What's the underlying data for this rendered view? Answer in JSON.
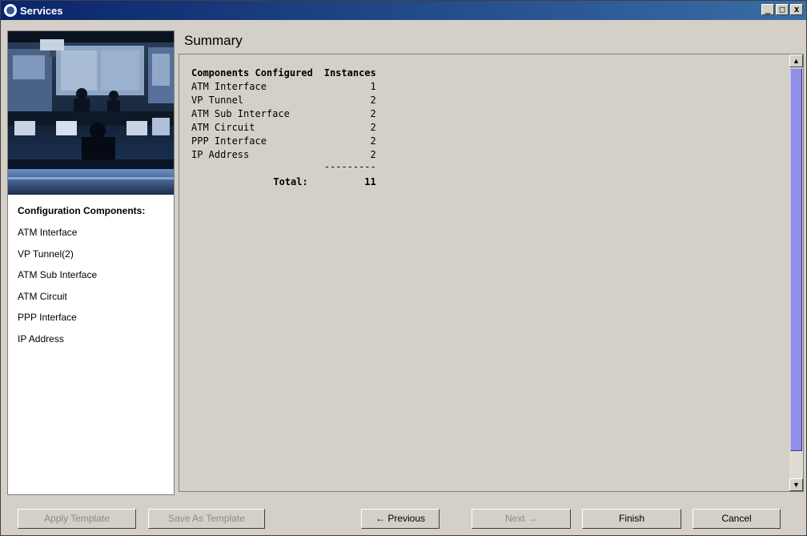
{
  "window": {
    "title": "Services",
    "buttons": {
      "minimize": "_",
      "maximize": "□",
      "close": "x"
    }
  },
  "sidebar": {
    "heading": "Configuration Components:",
    "items": [
      {
        "label": "ATM Interface"
      },
      {
        "label": "VP Tunnel(2)"
      },
      {
        "label": "ATM Sub Interface"
      },
      {
        "label": "ATM Circuit"
      },
      {
        "label": "PPP Interface"
      },
      {
        "label": "IP Address"
      }
    ]
  },
  "main": {
    "title": "Summary",
    "table": {
      "col_component": "Components Configured",
      "col_instances": "Instances",
      "rows": [
        {
          "name": "ATM Interface",
          "count": "1"
        },
        {
          "name": "VP Tunnel",
          "count": "2"
        },
        {
          "name": "ATM Sub Interface",
          "count": "2"
        },
        {
          "name": "ATM Circuit",
          "count": "2"
        },
        {
          "name": "PPP Interface",
          "count": "2"
        },
        {
          "name": "IP Address",
          "count": "2"
        }
      ],
      "separator": "---------",
      "total_label": "Total:",
      "total_value": "11"
    }
  },
  "footer": {
    "apply_template": "Apply Template",
    "save_as_template": "Save As Template",
    "previous": "Previous",
    "next": "Next",
    "finish": "Finish",
    "cancel": "Cancel"
  },
  "colors": {
    "titlebar_start": "#0a246a",
    "titlebar_end": "#3a6ea5",
    "background": "#d4d0c8",
    "scroll_thumb": "#8f8fe6"
  }
}
